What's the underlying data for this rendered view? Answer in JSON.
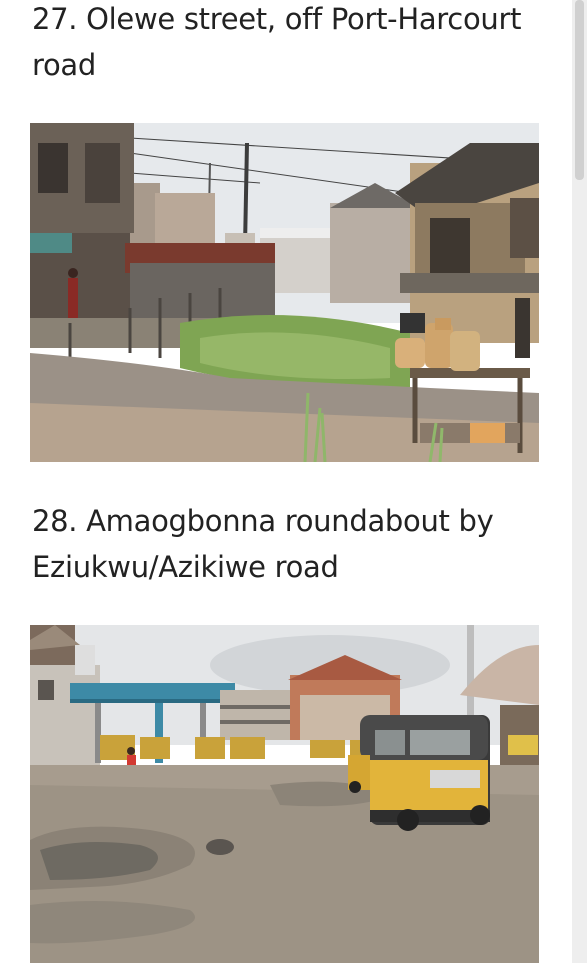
{
  "items": [
    {
      "heading": "27. Olewe street, off Port-Harcourt road"
    },
    {
      "heading": "28. Amaogbonna roundabout by Eziukwu/Azikiwe road"
    }
  ]
}
